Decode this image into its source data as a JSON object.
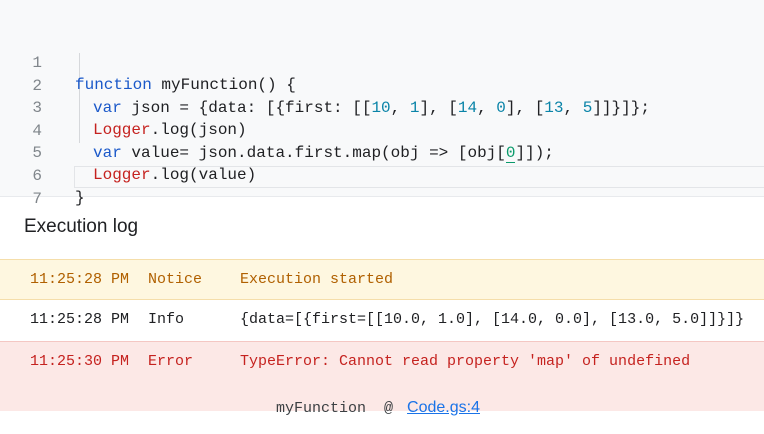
{
  "editor": {
    "line_numbers": [
      "1",
      "2",
      "3",
      "4",
      "5",
      "6",
      "7"
    ],
    "lines": [
      {
        "kw": "function",
        "rest": " myFunction() {"
      },
      {
        "kw": "var",
        "pre": " json = {data: [{first: [[",
        "n1": "10",
        "s1": ", ",
        "n2": "1",
        "s2": "], [",
        "n3": "14",
        "s3": ", ",
        "n4": "0",
        "s4": "], [",
        "n5": "13",
        "s5": ", ",
        "n6": "5",
        "tail": "]]}]};"
      },
      {
        "obj": "Logger",
        "rest": ".log(json)"
      },
      {
        "kw": "var",
        "pre": " value= json.data.first.map(obj => [obj[",
        "n1": "0",
        "tail": "]]);"
      },
      {
        "obj": "Logger",
        "rest": ".log(value)"
      },
      {
        "rest": "}"
      },
      {
        "rest": ""
      }
    ]
  },
  "log": {
    "title": "Execution log",
    "rows": [
      {
        "time": "11:25:28 PM",
        "level": "Notice",
        "message": "Execution started"
      },
      {
        "time": "11:25:28 PM",
        "level": "Info",
        "message": "{data=[{first=[[10.0, 1.0], [14.0, 0.0], [13.0, 5.0]]}]}"
      },
      {
        "time": "11:25:30 PM",
        "level": "Error",
        "message": "TypeError: Cannot read property 'map' of undefined"
      }
    ],
    "trace": {
      "function": "myFunction",
      "at": "@",
      "link": "Code.gs:4"
    }
  },
  "colors": {
    "notice_bg": "#fef7e0",
    "notice_text": "#b06000",
    "error_bg": "#fce8e6",
    "error_text": "#c5221f",
    "keyword": "#1a58c9",
    "link": "#1a73e8"
  }
}
